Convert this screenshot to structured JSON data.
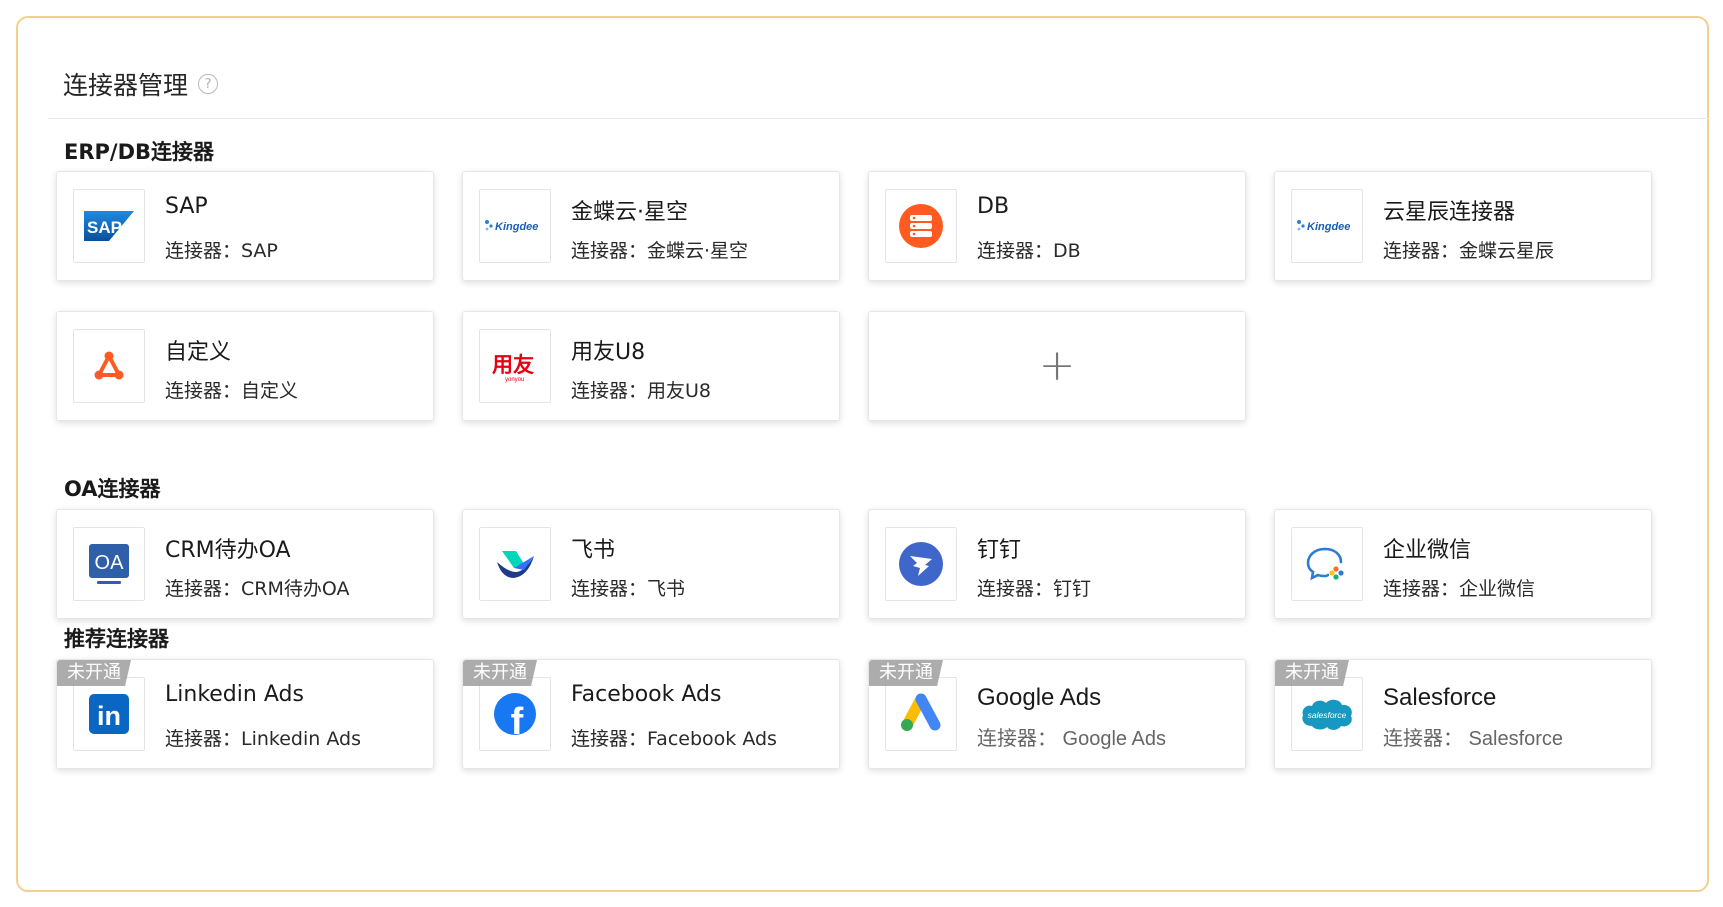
{
  "page": {
    "title": "连接器管理",
    "help_icon_glyph": "?"
  },
  "sections": [
    {
      "title": "ERP/DB连接器"
    },
    {
      "title": "OA连接器"
    },
    {
      "title": "推荐连接器"
    }
  ],
  "erp": [
    {
      "name": "SAP",
      "sub": "连接器：SAP",
      "logo_text": "SAP",
      "icon": "sap-logo"
    },
    {
      "name": "金蝶云·星空",
      "sub": "连接器：金蝶云·星空",
      "logo_text": "Kingdee",
      "icon": "kingdee-logo"
    },
    {
      "name": "DB",
      "sub": "连接器：DB",
      "icon": "database-icon"
    },
    {
      "name": "云星辰连接器",
      "sub": "连接器：金蝶云星辰",
      "logo_text": "Kingdee",
      "icon": "kingdee-logo"
    },
    {
      "name": "自定义",
      "sub": "连接器：自定义",
      "icon": "custom-connector-icon"
    },
    {
      "name": "用友U8",
      "sub": "连接器：用友U8",
      "logo_text": "用友",
      "logo_subtext": "yonyou",
      "icon": "yonyou-logo"
    }
  ],
  "add_card": {
    "glyph": "+"
  },
  "oa": [
    {
      "name": "CRM待办OA",
      "sub": "连接器：CRM待办OA",
      "logo_text": "OA",
      "icon": "oa-icon"
    },
    {
      "name": "飞书",
      "sub": "连接器：飞书",
      "icon": "feishu-logo"
    },
    {
      "name": "钉钉",
      "sub": "连接器：钉钉",
      "icon": "dingtalk-logo"
    },
    {
      "name": "企业微信",
      "sub": "连接器：企业微信",
      "icon": "wecom-logo"
    }
  ],
  "recommended": [
    {
      "name": "Linkedin Ads",
      "sub": "连接器：Linkedin Ads",
      "badge": "未开通",
      "logo_text": "in",
      "icon": "linkedin-logo"
    },
    {
      "name": "Facebook Ads",
      "sub": "连接器：Facebook Ads",
      "badge": "未开通",
      "logo_text": "f",
      "icon": "facebook-logo"
    },
    {
      "name": "Google Ads",
      "sub": "连接器：  Google Ads",
      "badge": "未开通",
      "icon": "google-ads-logo"
    },
    {
      "name": "Salesforce",
      "sub": "连接器：  Salesforce",
      "badge": "未开通",
      "logo_text": "salesforce",
      "icon": "salesforce-logo"
    }
  ],
  "colors": {
    "frame_border": "#f2d08f",
    "db_orange": "#ff5a1f",
    "yonyou_red": "#e60012",
    "oa_blue": "#2f5fa8",
    "linkedin_blue": "#0a66c2",
    "facebook_blue": "#1877f2",
    "dingtalk_blue": "#3f66c9",
    "salesforce_blue": "#1798c1"
  }
}
